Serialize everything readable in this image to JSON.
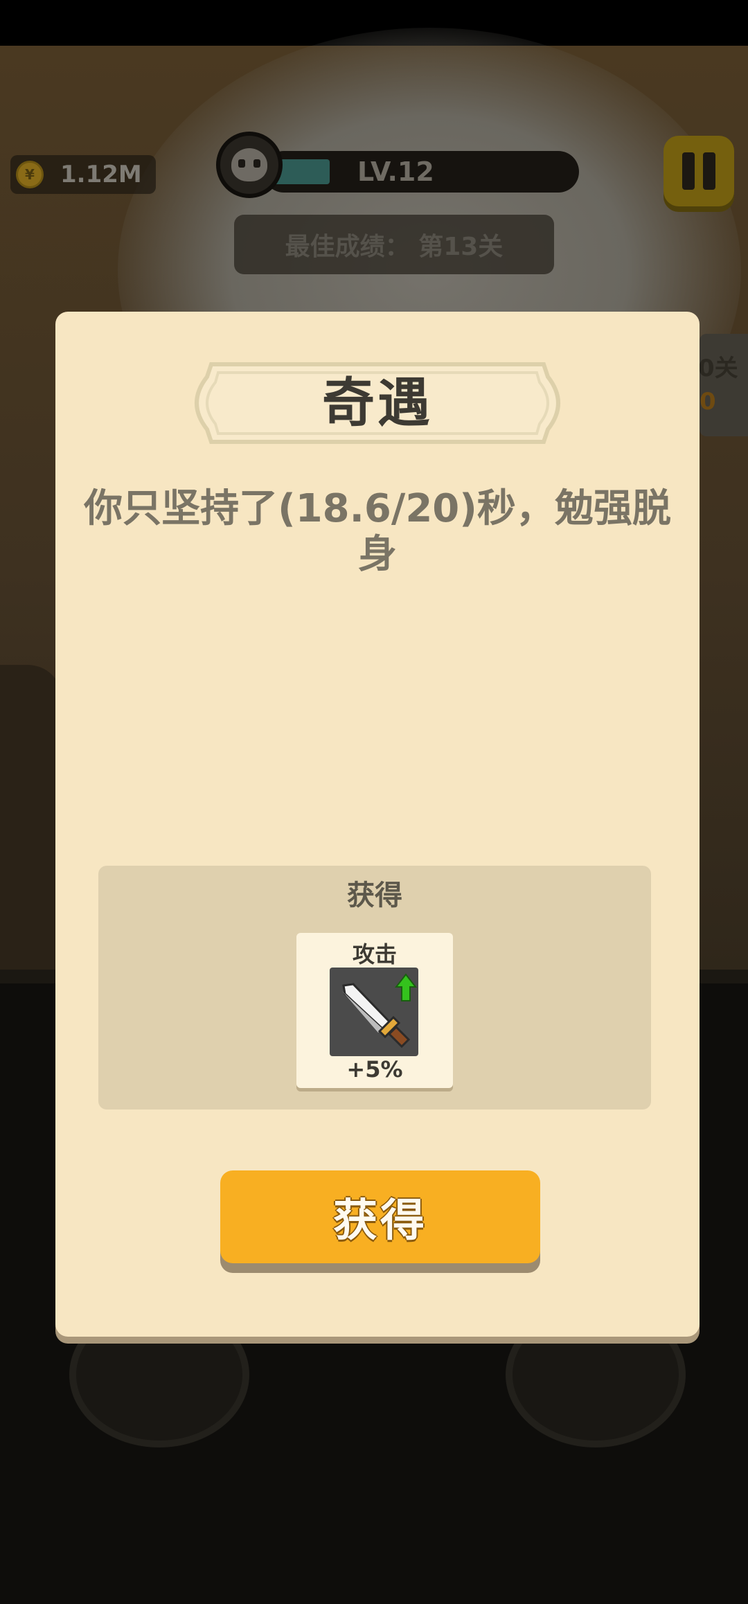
{
  "hud": {
    "coins": "1.12M",
    "level": "LV.12",
    "level_progress": 0.18,
    "best_score": "最佳成绩： 第13关",
    "side_text_top": "0关",
    "side_text_bottom": "0"
  },
  "dialog": {
    "title": "奇遇",
    "message": "你只坚持了(18.6/20)秒，勉强脱身",
    "reward_panel_title": "获得",
    "reward": {
      "label": "攻击",
      "icon": "sword-upgrade-icon",
      "value": "+5%"
    },
    "claim_button": "获得"
  },
  "colors": {
    "dialog_bg": "#f7e6c2",
    "button": "#f8af22",
    "reward_panel": "#dfd0ae",
    "upgrade_arrow": "#34c21d"
  }
}
